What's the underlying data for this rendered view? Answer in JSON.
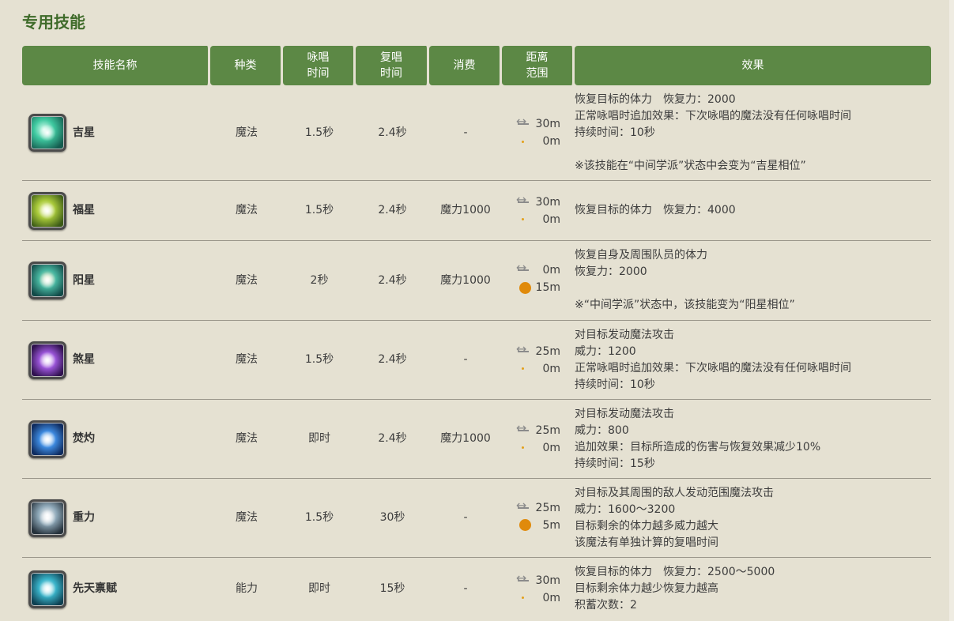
{
  "section": {
    "title": "专用技能"
  },
  "headers": {
    "name": "技能名称",
    "type": "种类",
    "cast_1": "咏唱",
    "cast_2": "时间",
    "recast_1": "复唱",
    "recast_2": "时间",
    "cost": "消费",
    "range_1": "距离",
    "range_2": "范围",
    "effect": "效果"
  },
  "colors": {
    "header_bg": "#5c8845",
    "title": "#3f6b2a",
    "aoe_dot": "#e08a0b"
  },
  "skills": [
    {
      "name": "吉星",
      "icon": "aspected-benefic-icon",
      "type": "魔法",
      "cast": "1.5秒",
      "recast": "2.4秒",
      "cost": "-",
      "distance": "30m",
      "radius": "0m",
      "effect": [
        "恢复目标的体力　恢复力：2000",
        "正常咏唱时追加效果：下次咏唱的魔法没有任何咏唱时间",
        "持续时间：10秒",
        "",
        "※该技能在“中间学派”状态中会变为“吉星相位”"
      ]
    },
    {
      "name": "福星",
      "icon": "benefic-ii-icon",
      "type": "魔法",
      "cast": "1.5秒",
      "recast": "2.4秒",
      "cost": "魔力1000",
      "distance": "30m",
      "radius": "0m",
      "effect": [
        "恢复目标的体力　恢复力：4000"
      ]
    },
    {
      "name": "阳星",
      "icon": "helios-icon",
      "type": "魔法",
      "cast": "2秒",
      "recast": "2.4秒",
      "cost": "魔力1000",
      "distance": "0m",
      "radius": "15m",
      "effect": [
        "恢复自身及周围队员的体力",
        "恢复力：2000",
        "",
        "※“中间学派”状态中，该技能变为“阳星相位”"
      ]
    },
    {
      "name": "煞星",
      "icon": "malefic-icon",
      "type": "魔法",
      "cast": "1.5秒",
      "recast": "2.4秒",
      "cost": "-",
      "distance": "25m",
      "radius": "0m",
      "effect": [
        "对目标发动魔法攻击",
        "威力：1200",
        "正常咏唱时追加效果：下次咏唱的魔法没有任何咏唱时间",
        "持续时间：10秒"
      ]
    },
    {
      "name": "焚灼",
      "icon": "combust-icon",
      "type": "魔法",
      "cast": "即时",
      "recast": "2.4秒",
      "cost": "魔力1000",
      "distance": "25m",
      "radius": "0m",
      "effect": [
        "对目标发动魔法攻击",
        "威力：800",
        "追加效果：目标所造成的伤害与恢复效果减少10%",
        "持续时间：15秒"
      ]
    },
    {
      "name": "重力",
      "icon": "gravity-icon",
      "type": "魔法",
      "cast": "1.5秒",
      "recast": "30秒",
      "cost": "-",
      "distance": "25m",
      "radius": "5m",
      "effect": [
        "对目标及其周围的敌人发动范围魔法攻击",
        "威力：1600～3200",
        "目标剩余的体力越多威力越大",
        "该魔法有单独计算的复唱时间"
      ]
    },
    {
      "name": "先天禀赋",
      "icon": "essential-dignity-icon",
      "type": "能力",
      "cast": "即时",
      "recast": "15秒",
      "cost": "-",
      "distance": "30m",
      "radius": "0m",
      "effect": [
        "恢复目标的体力　恢复力：2500～5000",
        "目标剩余体力越少恢复力越高",
        "积蓄次数：2"
      ]
    }
  ]
}
